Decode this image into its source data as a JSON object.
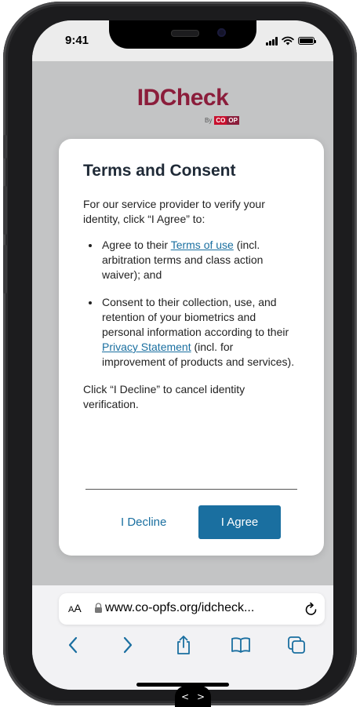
{
  "status_bar": {
    "time": "9:41"
  },
  "logo": {
    "title": "IDCheck",
    "by": "By",
    "brand_left": "CO",
    "brand_right": "OP"
  },
  "modal": {
    "title": "Terms and Consent",
    "intro": "For our service provider to verify your identity, click “I Agree” to:",
    "bullet1_before": "Agree to their ",
    "bullet1_link": "Terms of use",
    "bullet1_after": " (incl. arbitration terms and class action waiver); and",
    "bullet2_before": "Consent to their collection, use, and retention of your biometrics and personal information according to their ",
    "bullet2_link": "Privacy Statement",
    "bullet2_after": " (incl. for improvement of products and services).",
    "footer_text": "Click “I Decline” to cancel identity verification.",
    "decline_label": "I Decline",
    "agree_label": "I Agree"
  },
  "browser": {
    "text_size_small": "A",
    "text_size_large": "A",
    "url": "www.co-opfs.org/idcheck...",
    "toolbar": [
      "back-icon",
      "forward-icon",
      "share-icon",
      "bookmarks-icon",
      "tabs-icon"
    ]
  },
  "nav_pill": {
    "prev": "<",
    "next": ">"
  },
  "colors": {
    "accent": "#1a6fa0",
    "brand": "#8b1d3b",
    "brand_left_bg": "#c8102e",
    "brand_right_bg": "#8b1d3b",
    "backdrop": "#c3c4c5"
  }
}
